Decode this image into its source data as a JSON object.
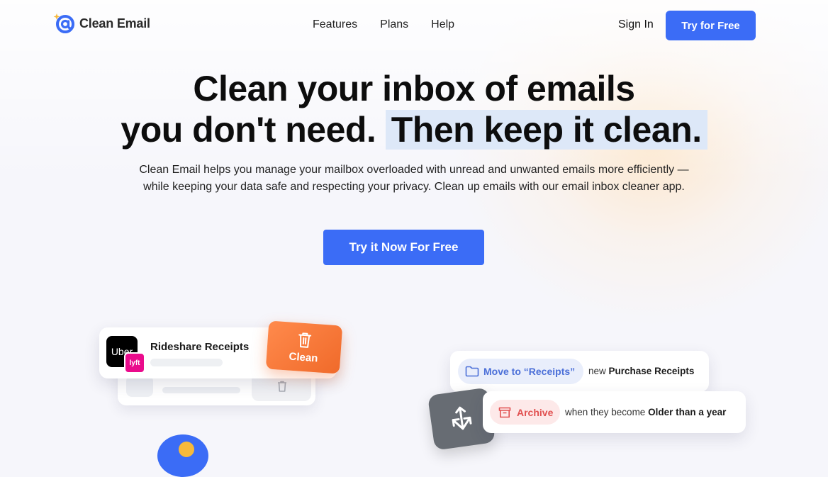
{
  "brand": {
    "name": "Clean Email"
  },
  "nav": {
    "items": [
      {
        "label": "Features"
      },
      {
        "label": "Plans"
      },
      {
        "label": "Help"
      }
    ],
    "sign_in": "Sign In",
    "try_free": "Try for Free"
  },
  "hero": {
    "title_line1": "Clean your inbox of emails",
    "title_line2a": "you don't need.",
    "title_line2b": "Then keep it clean.",
    "subtitle": "Clean Email helps you manage your mailbox overloaded with unread and unwanted emails more efficiently — while keeping your data safe and respecting your privacy. Clean up emails with our email inbox cleaner app.",
    "cta": "Try it Now For Free"
  },
  "demo": {
    "rideshare": {
      "title": "Rideshare Receipts",
      "uber_logo_text": "Uber",
      "lyft_logo_text": "lyft",
      "clean_label": "Clean"
    },
    "rules": [
      {
        "action": "Move to “Receipts”",
        "prefix": "new",
        "emphasis": "Purchase Receipts",
        "suffix": ""
      },
      {
        "action": "Archive",
        "prefix": "when they become",
        "emphasis": "Older than a year",
        "suffix": ""
      }
    ]
  },
  "colors": {
    "primary": "#3b6cf6",
    "clean_orange": "#f06a2a",
    "archive_red": "#e15050",
    "highlight": "#dde8f8"
  }
}
